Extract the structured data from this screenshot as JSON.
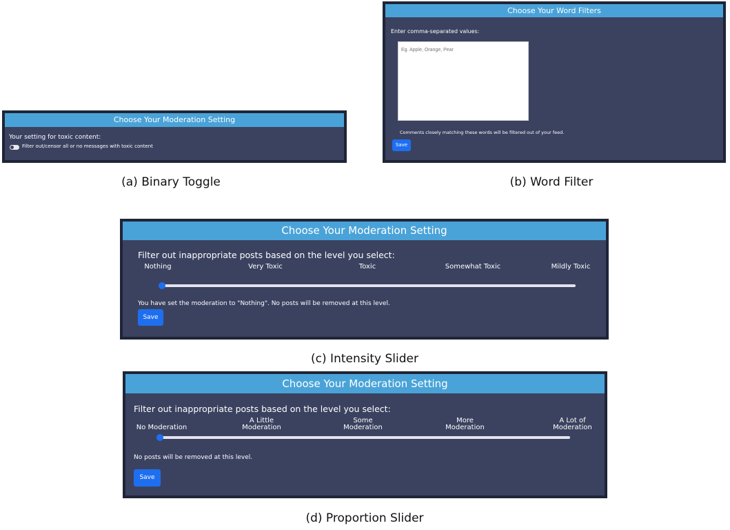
{
  "panel_a": {
    "header": "Choose Your Moderation Setting",
    "setting_label": "Your setting for toxic content:",
    "toggle_label": "Filter out/censor all or no messages with toxic content",
    "toggle_on": false
  },
  "caption_a": "(a) Binary Toggle",
  "panel_b": {
    "header": "Choose Your Word Filters",
    "prompt": "Enter comma-separated values:",
    "textarea_placeholder": "Eg. Apple, Orange, Pear",
    "note": "Comments closely matching these words will be filtered out of your feed.",
    "save": "Save"
  },
  "caption_b": "(b) Word Filter",
  "panel_c": {
    "header": "Choose Your Moderation Setting",
    "prompt": "Filter out inappropriate posts based on the level you select:",
    "levels": [
      "Nothing",
      "Very Toxic",
      "Toxic",
      "Somewhat Toxic",
      "Mildly Toxic"
    ],
    "selected_level_index": 0,
    "status": "You have set the moderation to \"Nothing\". No posts will be removed at this level.",
    "save": "Save"
  },
  "caption_c": "(c) Intensity Slider",
  "panel_d": {
    "header": "Choose Your Moderation Setting",
    "prompt": "Filter out inappropriate posts based on the level you select:",
    "levels": [
      [
        "No Moderation"
      ],
      [
        "A Little",
        "Moderation"
      ],
      [
        "Some",
        "Moderation"
      ],
      [
        "More",
        "Moderation"
      ],
      [
        "A Lot of",
        "Moderation"
      ]
    ],
    "selected_level_index": 0,
    "status": "No posts will be removed at this level.",
    "save": "Save"
  },
  "caption_d": "(d) Proportion Slider",
  "colors": {
    "panel_frame": "#1f2537",
    "panel_body": "#3b4260",
    "header": "#4aa3d8",
    "button": "#1e6ff0",
    "track": "#e4e4ee"
  }
}
